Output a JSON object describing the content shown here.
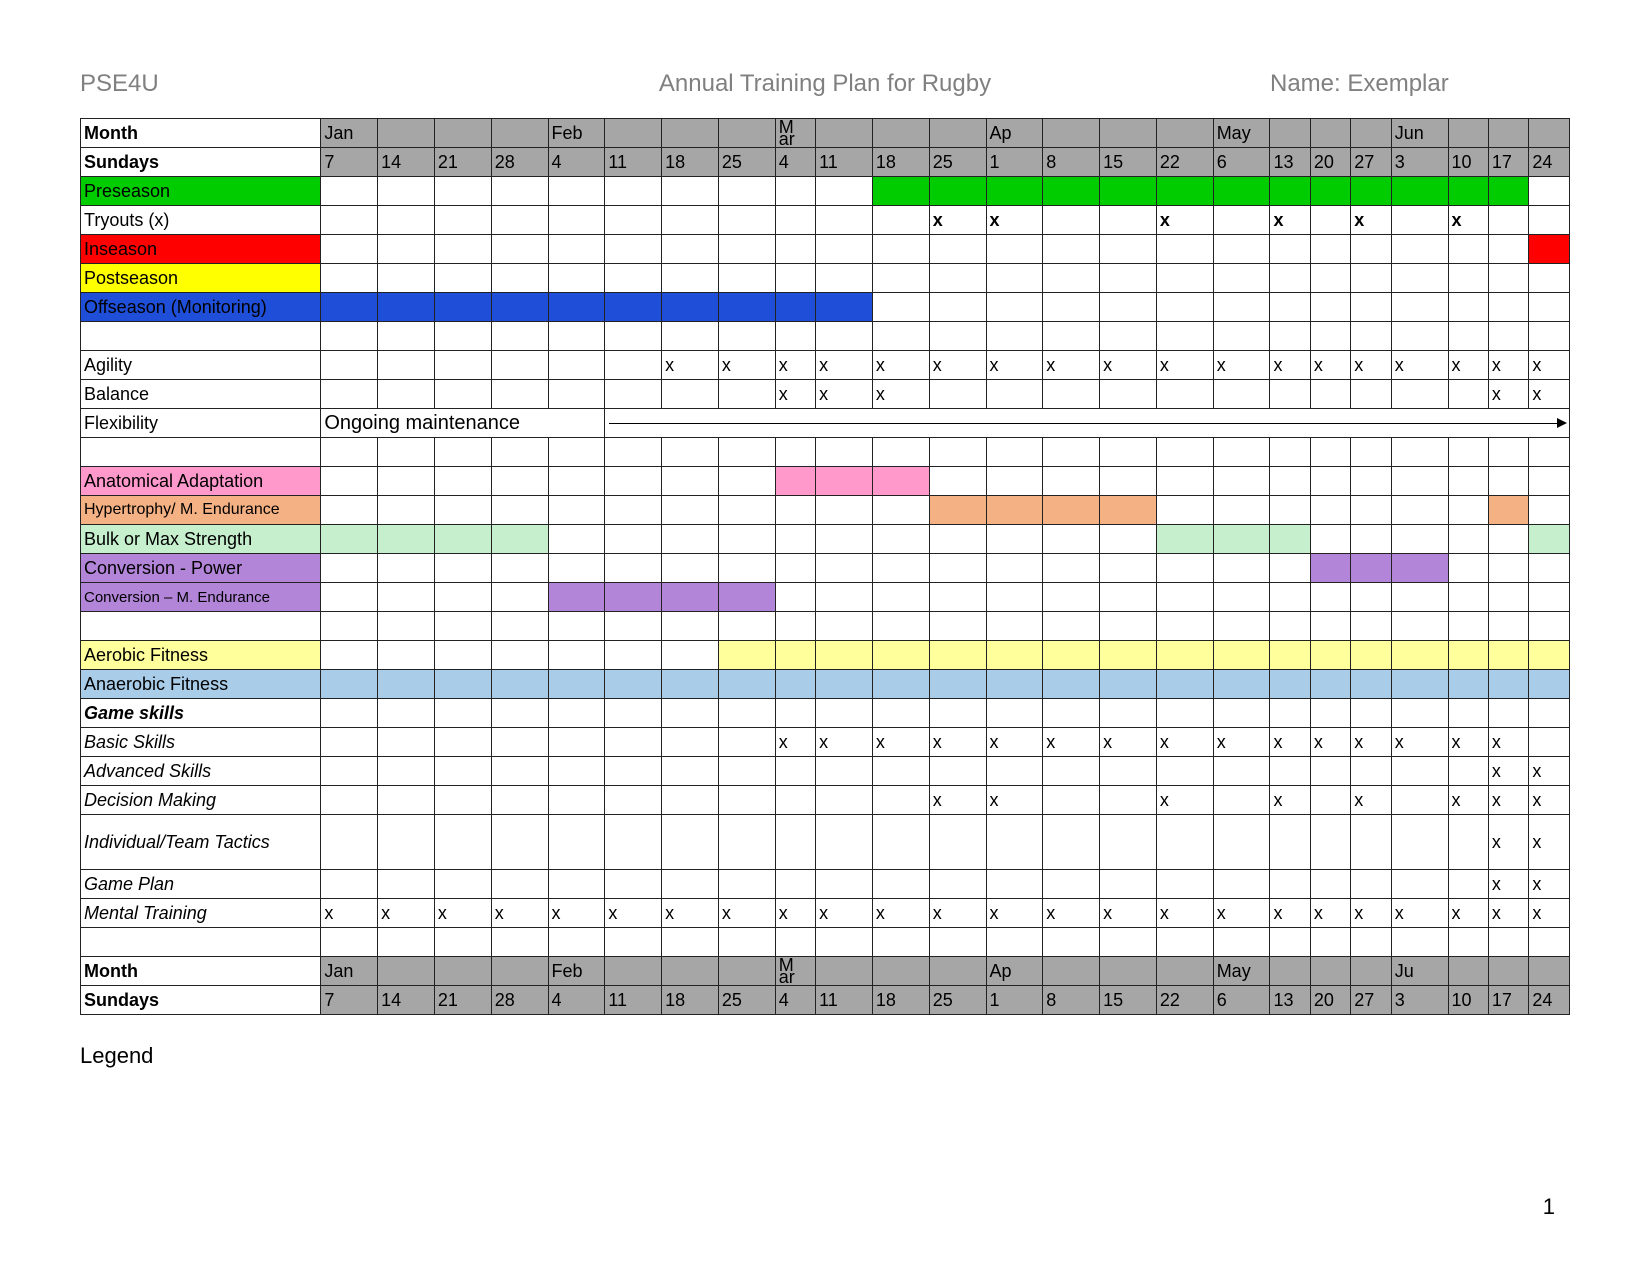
{
  "header": {
    "left": "PSE4U",
    "center": "Annual Training Plan for Rugby",
    "right": "Name: Exemplar"
  },
  "legend": "Legend",
  "page_number": "1",
  "labels": {
    "month": "Month",
    "sundays": "Sundays",
    "preseason": "Preseason",
    "tryouts": "Tryouts (x)",
    "inseason": "Inseason",
    "postseason": "Postseason",
    "offseason": "Offseason (Monitoring)",
    "agility": "Agility",
    "balance": "Balance",
    "flexibility": "Flexibility",
    "flex_note": "Ongoing maintenance",
    "anat": "Anatomical Adaptation",
    "hyper": "Hypertrophy/ M. Endurance",
    "bulk": "Bulk or Max Strength",
    "convp": "Conversion - Power",
    "convm": "Conversion – M. Endurance",
    "aer": "Aerobic Fitness",
    "anaer": "Anaerobic Fitness",
    "game": "Game skills",
    "basic": "Basic Skills",
    "adv": "Advanced Skills",
    "dec": "Decision Making",
    "tact": "Individual/Team Tactics",
    "plan": "Game Plan",
    "mental": "Mental Training"
  },
  "months": [
    "Jan",
    "",
    "",
    "",
    "Feb",
    "",
    "",
    "",
    "M\nar",
    "",
    "",
    "",
    "Ap",
    "",
    "",
    "",
    "May",
    "",
    "",
    "",
    "Jun",
    "",
    "",
    ""
  ],
  "months2": [
    "Jan",
    "",
    "",
    "",
    "Feb",
    "",
    "",
    "",
    "M\nar",
    "",
    "",
    "",
    "Ap",
    "",
    "",
    "",
    "May",
    "",
    "",
    "",
    "Ju",
    "",
    "",
    ""
  ],
  "sundays": [
    "7",
    "14",
    "21",
    "28",
    "4",
    "11",
    "18",
    "25",
    "4",
    "11",
    "18",
    "25",
    "1",
    "8",
    "15",
    "22",
    "6",
    "13",
    "20",
    "27",
    "3",
    "10",
    "17",
    "24"
  ],
  "chart_data": {
    "type": "table",
    "columns_are": "weeks (Sundays) Jan–Jun, 24 columns",
    "rows": {
      "Preseason_fill": [
        0,
        0,
        0,
        0,
        0,
        0,
        0,
        0,
        0,
        0,
        1,
        1,
        1,
        1,
        1,
        1,
        1,
        1,
        1,
        1,
        1,
        1,
        1,
        0
      ],
      "Tryouts_x": [
        0,
        0,
        0,
        0,
        0,
        0,
        0,
        0,
        0,
        0,
        0,
        1,
        1,
        0,
        0,
        1,
        0,
        1,
        0,
        1,
        0,
        1,
        0,
        0
      ],
      "Inseason_fill": [
        0,
        0,
        0,
        0,
        0,
        0,
        0,
        0,
        0,
        0,
        0,
        0,
        0,
        0,
        0,
        0,
        0,
        0,
        0,
        0,
        0,
        0,
        0,
        1
      ],
      "Offseason_fill": [
        1,
        1,
        1,
        1,
        1,
        1,
        1,
        1,
        1,
        1,
        0,
        0,
        0,
        0,
        0,
        0,
        0,
        0,
        0,
        0,
        0,
        0,
        0,
        0
      ],
      "Agility_x": [
        0,
        0,
        0,
        0,
        0,
        0,
        1,
        1,
        1,
        1,
        1,
        1,
        1,
        1,
        1,
        1,
        1,
        1,
        1,
        1,
        1,
        1,
        1,
        1
      ],
      "Balance_x": [
        0,
        0,
        0,
        0,
        0,
        0,
        0,
        0,
        1,
        1,
        1,
        0,
        0,
        0,
        0,
        0,
        0,
        0,
        0,
        0,
        0,
        0,
        1,
        1
      ],
      "Anat_fill": [
        0,
        0,
        0,
        0,
        0,
        0,
        0,
        0,
        1,
        1,
        1,
        0,
        0,
        0,
        0,
        0,
        0,
        0,
        0,
        0,
        0,
        0,
        0,
        0
      ],
      "Hyper_fill": [
        0,
        0,
        0,
        0,
        0,
        0,
        0,
        0,
        0,
        0,
        0,
        1,
        1,
        1,
        1,
        0,
        0,
        0,
        0,
        0,
        0,
        0,
        1,
        0
      ],
      "Bulk_fill": [
        1,
        1,
        1,
        1,
        0,
        0,
        0,
        0,
        0,
        0,
        0,
        0,
        0,
        0,
        0,
        1,
        1,
        1,
        0,
        0,
        0,
        0,
        0,
        1
      ],
      "ConvP_fill": [
        0,
        0,
        0,
        0,
        0,
        0,
        0,
        0,
        0,
        0,
        0,
        0,
        0,
        0,
        0,
        0,
        0,
        0,
        1,
        1,
        1,
        0,
        0,
        0
      ],
      "ConvM_fill": [
        0,
        0,
        0,
        0,
        1,
        1,
        1,
        1,
        0,
        0,
        0,
        0,
        0,
        0,
        0,
        0,
        0,
        0,
        0,
        0,
        0,
        0,
        0,
        0
      ],
      "Aerobic_fill": [
        0,
        0,
        0,
        0,
        0,
        0,
        0,
        1,
        1,
        1,
        1,
        1,
        1,
        1,
        1,
        1,
        1,
        1,
        1,
        1,
        1,
        1,
        1,
        1
      ],
      "Anaer_fill": [
        1,
        1,
        1,
        1,
        1,
        1,
        1,
        1,
        1,
        1,
        1,
        1,
        1,
        1,
        1,
        1,
        1,
        1,
        1,
        1,
        1,
        1,
        1,
        1
      ],
      "Basic_x": [
        0,
        0,
        0,
        0,
        0,
        0,
        0,
        0,
        1,
        1,
        1,
        1,
        1,
        1,
        1,
        1,
        1,
        1,
        1,
        1,
        1,
        1,
        1,
        0
      ],
      "Adv_x": [
        0,
        0,
        0,
        0,
        0,
        0,
        0,
        0,
        0,
        0,
        0,
        0,
        0,
        0,
        0,
        0,
        0,
        0,
        0,
        0,
        0,
        0,
        1,
        1
      ],
      "Dec_x": [
        0,
        0,
        0,
        0,
        0,
        0,
        0,
        0,
        0,
        0,
        0,
        1,
        1,
        0,
        0,
        1,
        0,
        1,
        0,
        1,
        0,
        1,
        1,
        1
      ],
      "Tact_x": [
        0,
        0,
        0,
        0,
        0,
        0,
        0,
        0,
        0,
        0,
        0,
        0,
        0,
        0,
        0,
        0,
        0,
        0,
        0,
        0,
        0,
        0,
        1,
        1
      ],
      "Plan_x": [
        0,
        0,
        0,
        0,
        0,
        0,
        0,
        0,
        0,
        0,
        0,
        0,
        0,
        0,
        0,
        0,
        0,
        0,
        0,
        0,
        0,
        0,
        1,
        1
      ],
      "Mental_x": [
        1,
        1,
        1,
        1,
        1,
        1,
        1,
        1,
        1,
        1,
        1,
        1,
        1,
        1,
        1,
        1,
        1,
        1,
        1,
        1,
        1,
        1,
        1,
        1
      ]
    }
  }
}
